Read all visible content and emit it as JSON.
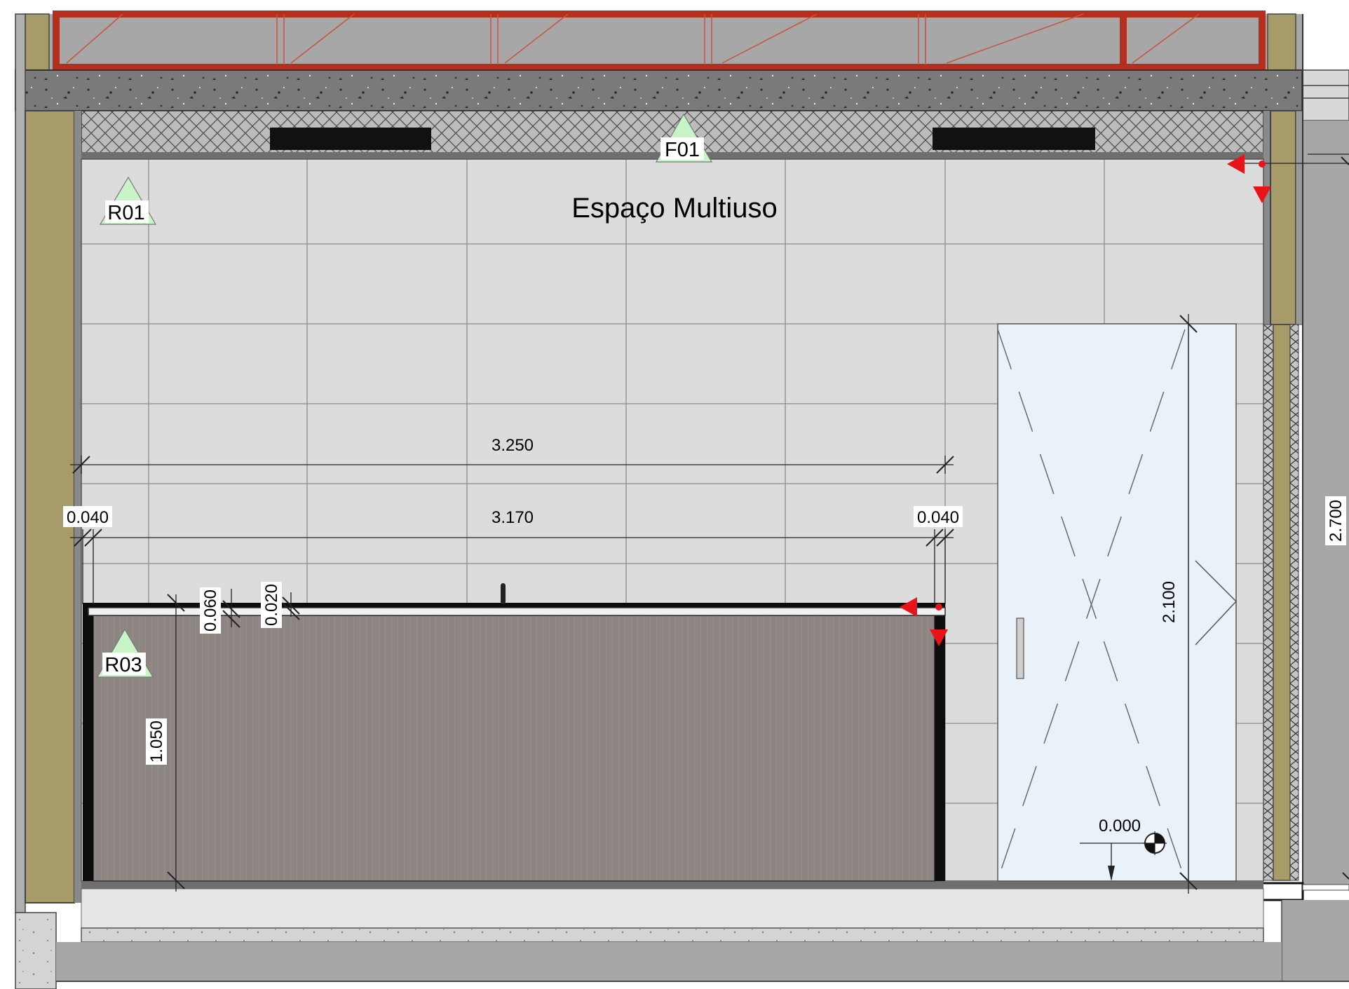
{
  "room_name": "Espaço Multiuso",
  "tags": {
    "r01": "R01",
    "r03": "R03",
    "f01": "F01"
  },
  "dimensions": {
    "overall_width": "3.250",
    "inner_width": "3.170",
    "left_offset": "0.040",
    "right_offset": "0.040",
    "top_board": "0.060",
    "top_lip": "0.020",
    "counter_height": "1.050",
    "door_height": "2.100",
    "ceiling_height": "2.700"
  },
  "level": "0.000",
  "colors": {
    "wall_tile": "#dcdcdc",
    "tile_grid": "#8c8c8c",
    "counter_panel": "#8c8581",
    "glass_door": "#e9f2f8",
    "slab": "#6f6f6f",
    "insulation": "#b9b9b9",
    "timber_post": "#a89b6a",
    "window_frame": "#b3301f",
    "section_marker": "#e8141a",
    "tag_fill": "#c8f5c8"
  },
  "icons": [
    "section-marker-icon",
    "elevation-tag-icon",
    "level-datum-icon"
  ]
}
